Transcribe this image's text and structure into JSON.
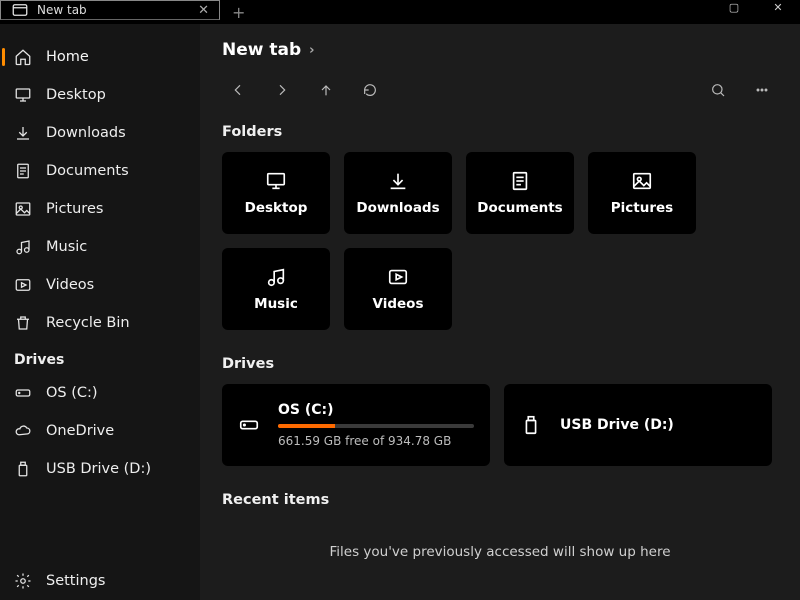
{
  "titlebar": {
    "tab_label": "New tab"
  },
  "sidebar": {
    "items": [
      {
        "label": "Home"
      },
      {
        "label": "Desktop"
      },
      {
        "label": "Downloads"
      },
      {
        "label": "Documents"
      },
      {
        "label": "Pictures"
      },
      {
        "label": "Music"
      },
      {
        "label": "Videos"
      },
      {
        "label": "Recycle Bin"
      }
    ],
    "drives_heading": "Drives",
    "drives": [
      {
        "label": "OS (C:)"
      },
      {
        "label": "OneDrive"
      },
      {
        "label": "USB Drive (D:)"
      }
    ],
    "settings_label": "Settings"
  },
  "main": {
    "breadcrumb": "New tab",
    "folders_heading": "Folders",
    "folders": [
      {
        "label": "Desktop"
      },
      {
        "label": "Downloads"
      },
      {
        "label": "Documents"
      },
      {
        "label": "Pictures"
      },
      {
        "label": "Music"
      },
      {
        "label": "Videos"
      }
    ],
    "drives_heading": "Drives",
    "drives": [
      {
        "name": "OS (C:)",
        "free_text": "661.59 GB free of 934.78 GB",
        "used_percent": 29
      },
      {
        "name": "USB Drive (D:)"
      }
    ],
    "recent_heading": "Recent items",
    "recent_empty": "Files you've previously accessed will show up here"
  }
}
